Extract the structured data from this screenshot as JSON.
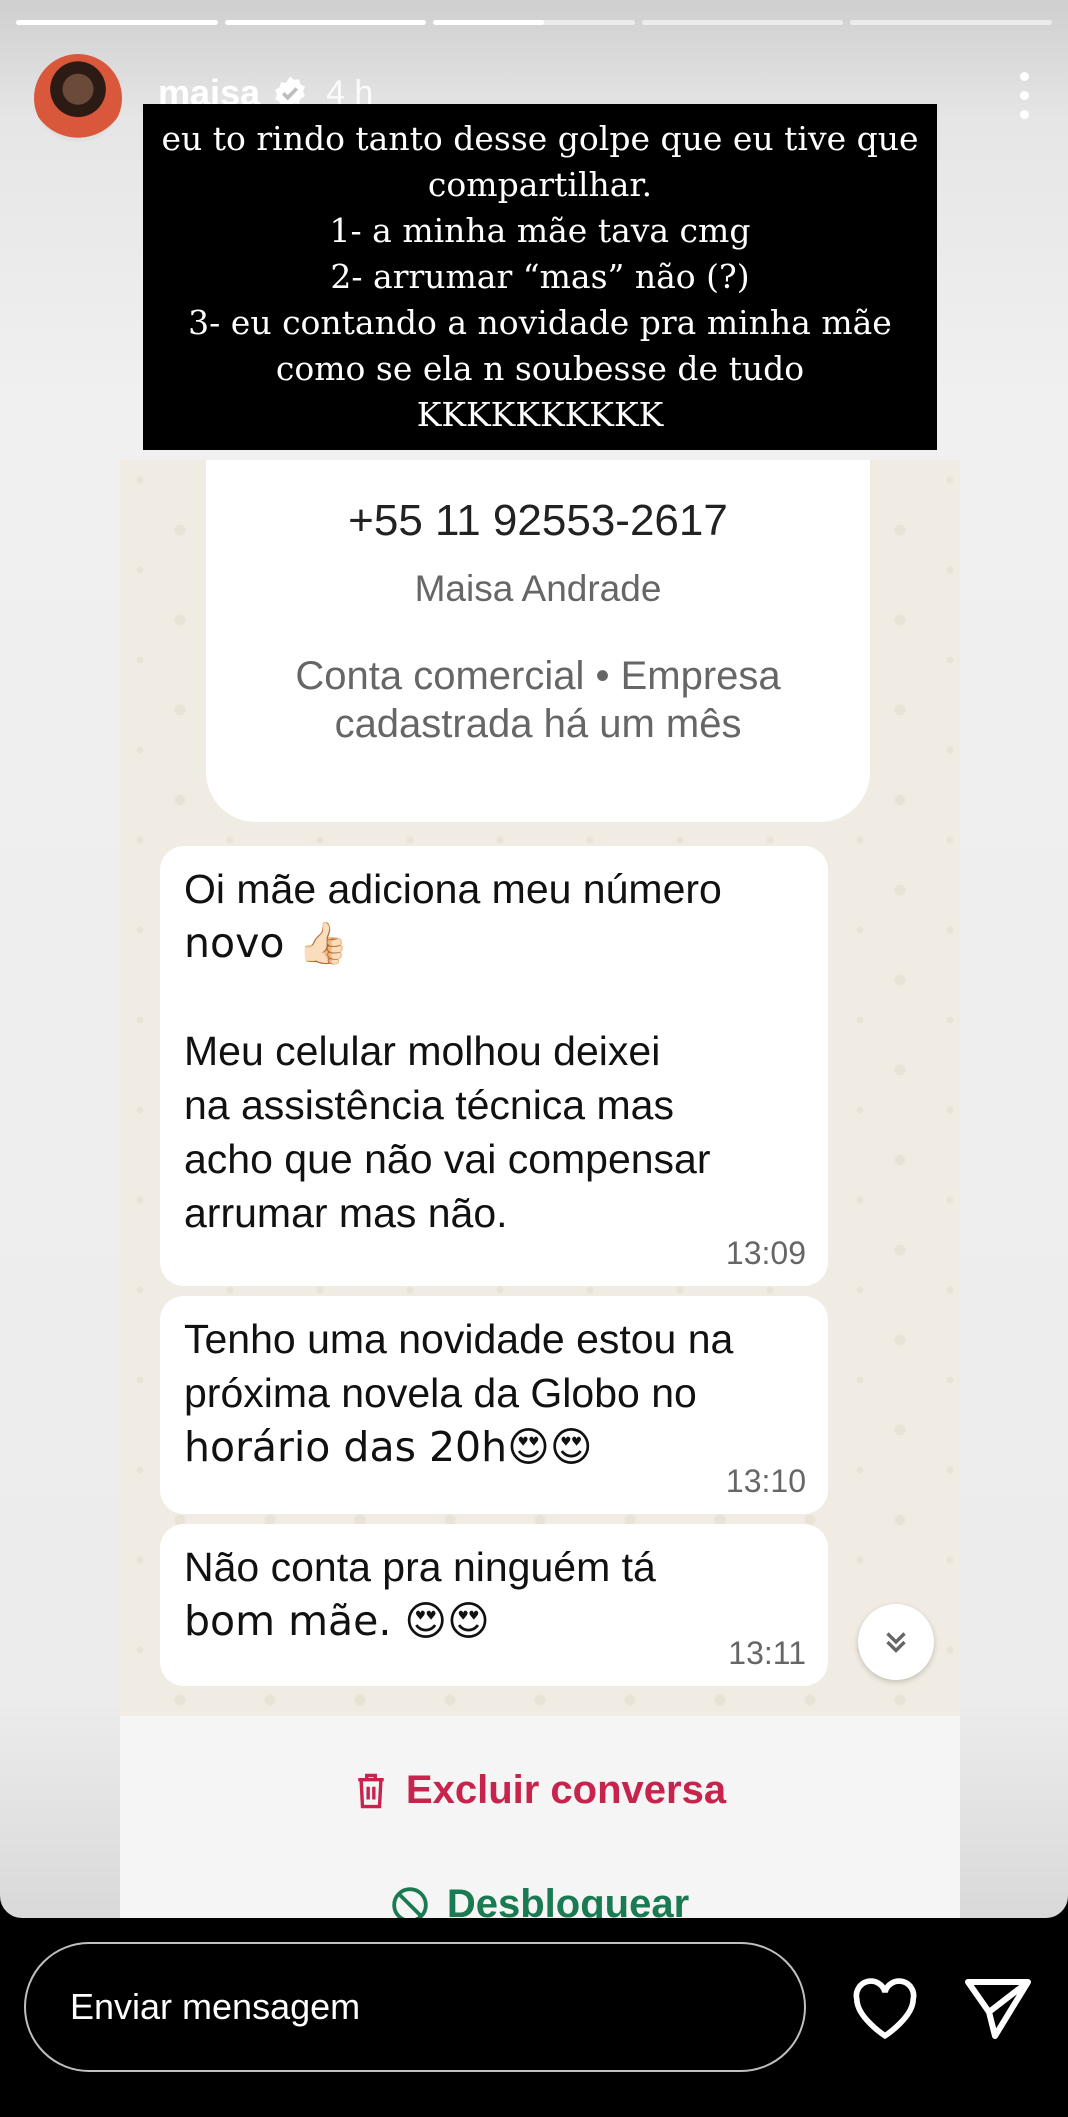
{
  "story": {
    "username": "maisa",
    "time_ago": "4 h",
    "caption_lines": [
      "eu to rindo tanto desse golpe que eu tive que",
      "compartilhar.",
      "1- a minha mãe tava cmg",
      "2- arrumar “mas” não (?)",
      "3- eu contando a novidade pra minha mãe",
      "como se ela n soubesse de tudo",
      "KKKKKKKKKK"
    ]
  },
  "chat": {
    "phone": "+55 11 92553-2617",
    "contact_name": "Maisa Andrade",
    "business_line1": "Conta comercial • Empresa",
    "business_line2": "cadastrada há um mês",
    "messages": [
      {
        "line1": "Oi mãe adiciona meu número",
        "line2": "novo 👍🏻",
        "line3": "Meu celular molhou deixei",
        "line4": "na assistência técnica mas",
        "line5": "acho que não vai compensar",
        "line6": "arrumar mas não.",
        "time": "13:09"
      },
      {
        "line1": "Tenho uma novidade estou na",
        "line2": "próxima novela da Globo no",
        "line3": "horário das 20h😍😍",
        "time": "13:10"
      },
      {
        "line1": "Não conta pra ninguém tá",
        "line2": "bom mãe. 😍😍",
        "time": "13:11"
      }
    ],
    "delete_label": "Excluir conversa",
    "unblock_label": "Desbloquear"
  },
  "reply": {
    "placeholder": "Enviar mensagem"
  },
  "colors": {
    "delete": "#c8234c",
    "unblock": "#1a7a52",
    "chat_bg": "#f1ece3"
  }
}
